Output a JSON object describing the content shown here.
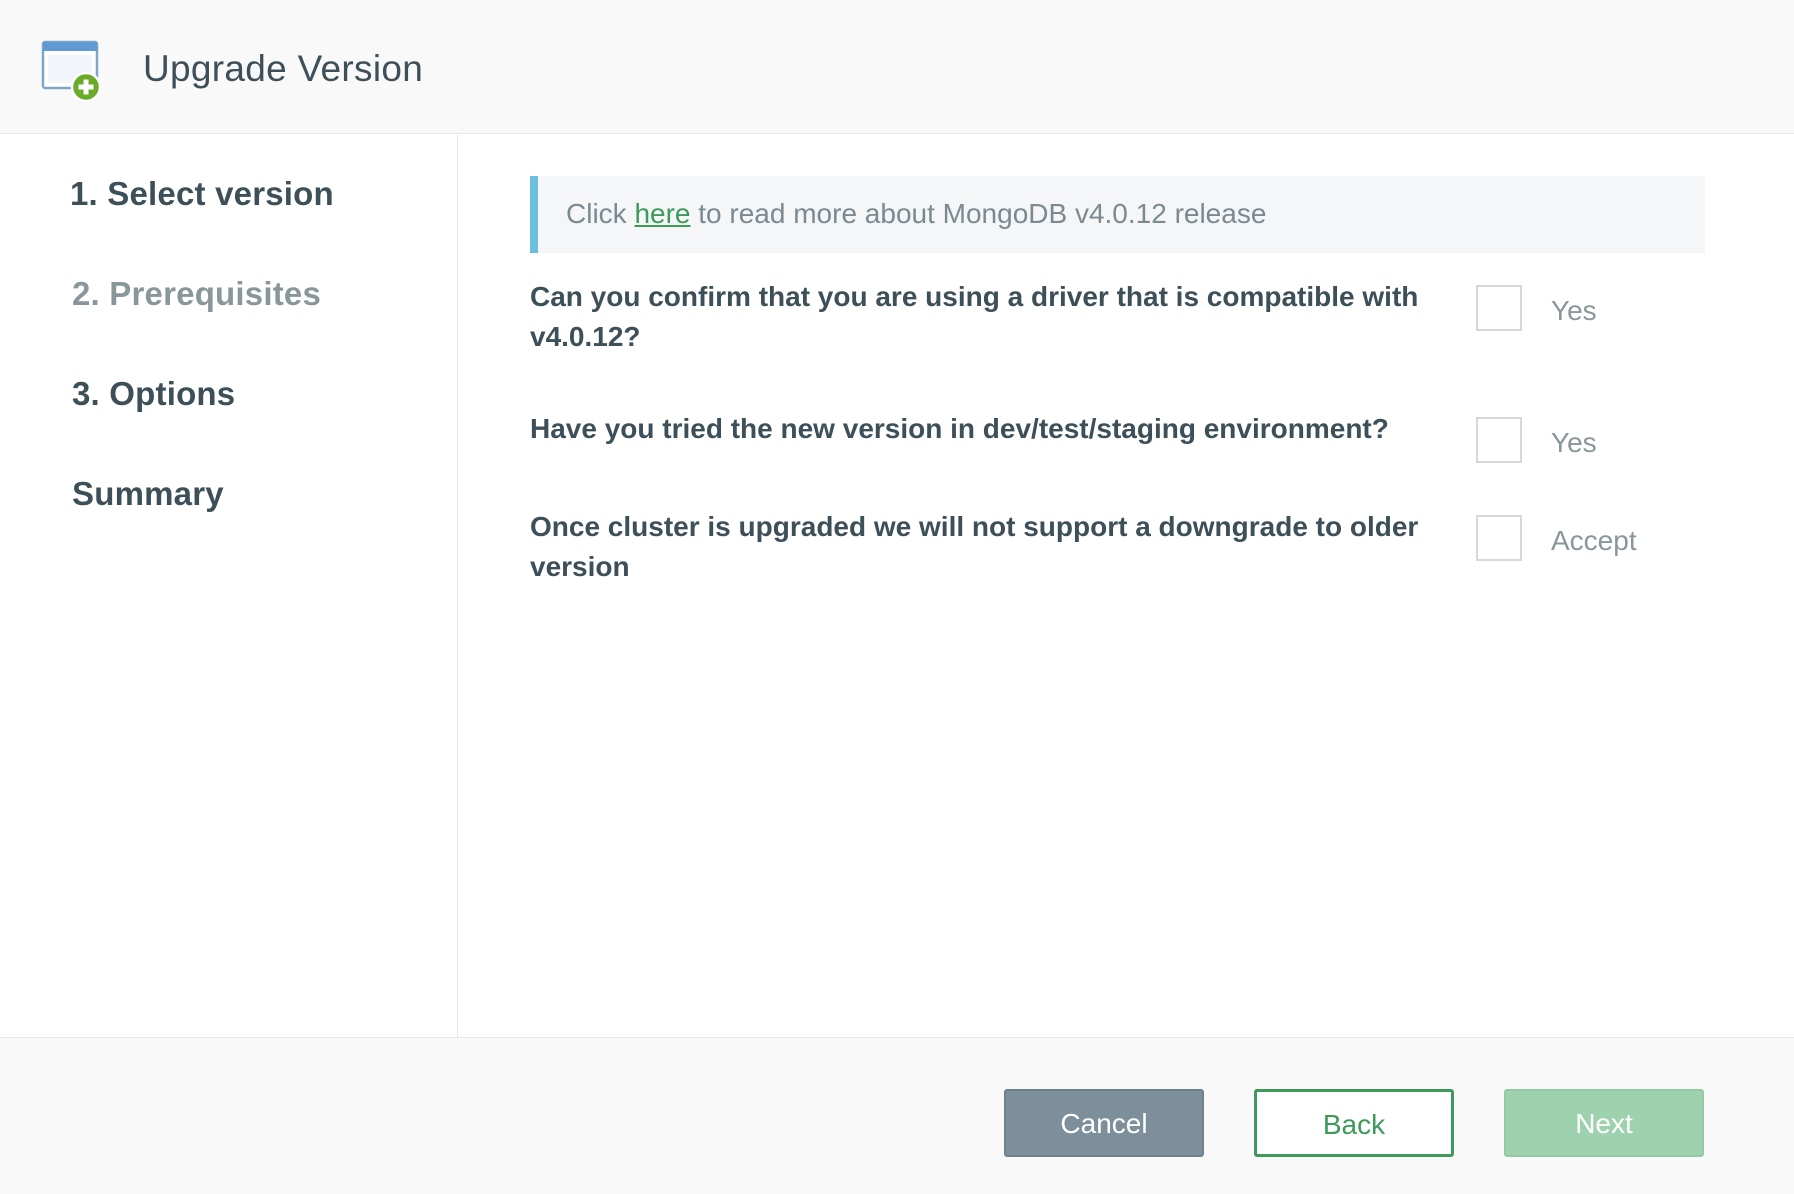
{
  "header": {
    "title": "Upgrade Version",
    "icon": "window-add-icon"
  },
  "sidebar": {
    "steps": [
      {
        "label": "1. Select version"
      },
      {
        "label": "2. Prerequisites",
        "current": true
      },
      {
        "label": "3. Options"
      },
      {
        "label": "Summary"
      }
    ]
  },
  "main": {
    "info": {
      "prefix": "Click ",
      "link_text": "here",
      "suffix": " to read more about MongoDB v4.0.12 release"
    },
    "questions": [
      {
        "text": "Can you confirm that you are using a driver that is compatible with v4.0.12?",
        "option_label": "Yes",
        "checked": false
      },
      {
        "text": "Have you tried the new version in dev/test/staging environment?",
        "option_label": "Yes",
        "checked": false
      },
      {
        "text": "Once cluster is upgraded we will not support a downgrade to older version",
        "option_label": "Accept",
        "checked": false
      }
    ]
  },
  "footer": {
    "cancel_label": "Cancel",
    "back_label": "Back",
    "next_label": "Next"
  },
  "colors": {
    "accent_green": "#3d9a5b",
    "info_border": "#6dbfe0",
    "next_disabled": "#9ed1ad",
    "cancel_gray": "#7c8f9a"
  }
}
